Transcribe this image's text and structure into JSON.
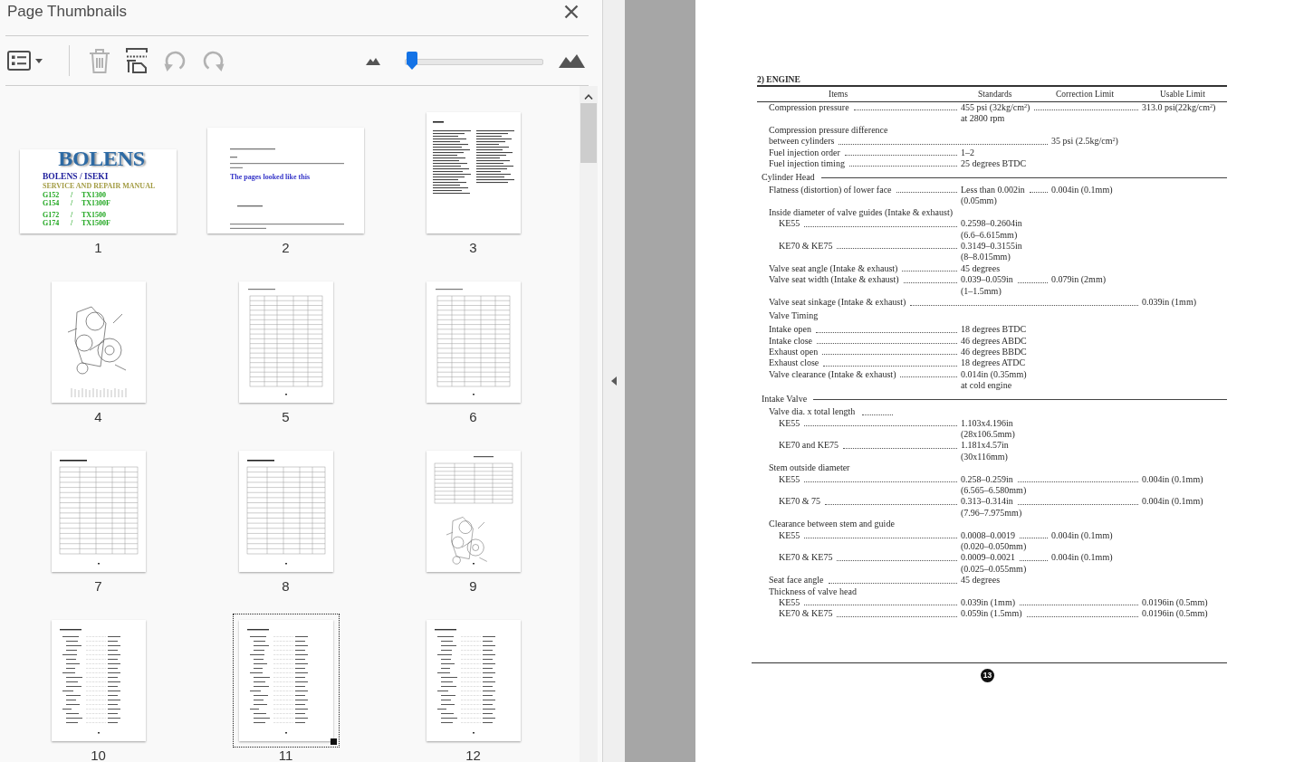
{
  "panel": {
    "title": "Page Thumbnails"
  },
  "toolbar": {
    "buttons": [
      {
        "kind": "options",
        "disabled": false
      },
      {
        "kind": "delete",
        "disabled": true
      },
      {
        "kind": "insert",
        "disabled": false
      },
      {
        "kind": "ccw",
        "disabled": true
      },
      {
        "kind": "cw",
        "disabled": true
      }
    ],
    "slider": {
      "level": 0.05
    }
  },
  "thumbnails": [
    {
      "label": "1",
      "kind": "cover",
      "selected": false,
      "title": "BOLENS",
      "subtitle": "BOLENS / ISEKI",
      "caption": "SERVICE AND REPAIR MANUAL",
      "model_groups": [
        [
          [
            "G152",
            "/",
            "TX1300"
          ],
          [
            "G154",
            "/",
            "TX1300F"
          ]
        ],
        [
          [
            "G172",
            "/",
            "TX1500"
          ],
          [
            "G174",
            "/",
            "TX1500F"
          ]
        ]
      ]
    },
    {
      "label": "2",
      "kind": "note",
      "selected": false,
      "notice": "The pages looked like this"
    },
    {
      "label": "3",
      "kind": "toc",
      "selected": false
    },
    {
      "label": "4",
      "kind": "figure",
      "selected": false
    },
    {
      "label": "5",
      "kind": "grid",
      "selected": false
    },
    {
      "label": "6",
      "kind": "grid",
      "selected": false
    },
    {
      "label": "7",
      "kind": "table",
      "selected": false
    },
    {
      "label": "8",
      "kind": "table",
      "selected": false
    },
    {
      "label": "9",
      "kind": "diagram",
      "selected": false
    },
    {
      "label": "10",
      "kind": "list",
      "selected": false
    },
    {
      "label": "11",
      "kind": "list",
      "selected": true
    },
    {
      "label": "12",
      "kind": "list",
      "selected": false
    }
  ],
  "document": {
    "title": "2) ENGINE",
    "columns": [
      "Items",
      "Standards",
      "Correction Limit",
      "Usable Limit"
    ],
    "sections": [
      {
        "entries": [
          {
            "kind": "spec",
            "label": "Compression pressure",
            "standard": [
              "455 psi (32kg/cm$^{2}$)",
              "at 2800 rpm"
            ],
            "usable": [
              "313.0 psi(22kg/cm$^{2}$)"
            ]
          },
          {
            "kind": "spec",
            "label_lead": "Compression pressure difference",
            "label": "between cylinders",
            "correction": [
              "35 psi (2.5kg/cm$^{2}$)"
            ]
          },
          {
            "kind": "spec",
            "label": "Fuel injection order",
            "standard": [
              "1–2"
            ]
          },
          {
            "kind": "spec",
            "label": "Fuel injection timing",
            "standard": [
              "25 degrees BTDC"
            ]
          }
        ]
      },
      {
        "heading": "Cylinder Head",
        "entries": [
          {
            "kind": "spec",
            "label": "Flatness (distortion) of lower face",
            "standard": [
              "Less than 0.002in",
              "(0.05mm)"
            ],
            "correction": [
              "0.004in (0.1mm)"
            ]
          },
          {
            "kind": "group",
            "label": "Inside diameter of valve guides (Intake & exhaust)",
            "leader": false,
            "children": [
              {
                "label": "KE55",
                "standard": [
                  "0.2598–0.2604in",
                  "(6.6–6.615mm)"
                ]
              },
              {
                "label": "KE70 & KE75",
                "standard": [
                  "0.3149–0.3155in",
                  "(8–8.015mm)"
                ]
              }
            ]
          },
          {
            "kind": "spec",
            "label": "Valve seat angle (Intake & exhaust)",
            "standard": [
              "45 degrees"
            ]
          },
          {
            "kind": "spec",
            "label": "Valve seat width (Intake & exhaust)",
            "standard": [
              "0.039–0.059in",
              "(1–1.5mm)"
            ],
            "correction": [
              "0.079in (2mm)"
            ]
          },
          {
            "kind": "spec",
            "label": "Valve seat sinkage (Intake & exhaust)",
            "usable": [
              "0.039in (1mm)"
            ]
          },
          {
            "kind": "subheading",
            "label": "Valve Timing"
          },
          {
            "kind": "spec",
            "label": "Intake open",
            "standard": [
              "18 degrees BTDC"
            ]
          },
          {
            "kind": "spec",
            "label": "Intake close",
            "standard": [
              "46 degrees ABDC"
            ]
          },
          {
            "kind": "spec",
            "label": "Exhaust open",
            "standard": [
              "46 degrees BBDC"
            ]
          },
          {
            "kind": "spec",
            "label": "Exhaust close",
            "standard": [
              "18 degrees ATDC"
            ]
          },
          {
            "kind": "spec",
            "label": "Valve clearance (Intake & exhaust)",
            "standard": [
              "0.014in (0.35mm)",
              "at cold engine"
            ]
          }
        ]
      },
      {
        "heading": "Intake Valve",
        "entries": [
          {
            "kind": "group",
            "label": "Valve dia. x total length",
            "leader": true,
            "children": [
              {
                "label": "KE55",
                "standard": [
                  "1.103x4.196in",
                  "(28x106.5mm)"
                ]
              },
              {
                "label": "KE70 and KE75",
                "standard": [
                  "1.181x4.57in",
                  "(30x116mm)"
                ]
              }
            ]
          },
          {
            "kind": "group",
            "label": "Stem outside diameter",
            "leader": false,
            "children": [
              {
                "label": "KE55",
                "standard": [
                  "0.258–0.259in",
                  "(6.565–6.580mm)"
                ],
                "usable": [
                  "0.004in (0.1mm)"
                ]
              },
              {
                "label": "KE70 & 75",
                "standard": [
                  "0.313–0.314in",
                  "(7.96–7.975mm)"
                ],
                "usable": [
                  "0.004in (0.1mm)"
                ]
              }
            ]
          },
          {
            "kind": "group",
            "label": "Clearance between stem and guide",
            "leader": false,
            "children": [
              {
                "label": "KE55",
                "standard": [
                  "0.0008–0.0019",
                  "(0.020–0.050mm)"
                ],
                "correction": [
                  "0.004in (0.1mm)"
                ]
              },
              {
                "label": "KE70 & KE75",
                "standard": [
                  "0.0009–0.0021",
                  "(0.025–0.055mm)"
                ],
                "correction": [
                  "0.004in (0.1mm)"
                ]
              }
            ]
          },
          {
            "kind": "spec",
            "label": "Seat face angle",
            "standard": [
              "45 degrees"
            ]
          },
          {
            "kind": "group",
            "label": "Thickness of valve head",
            "leader": false,
            "children": [
              {
                "label": "KE55",
                "standard": [
                  "0.039in (1mm)"
                ],
                "usable": [
                  "0.0196in (0.5mm)"
                ]
              },
              {
                "label": "KE70 & KE75",
                "standard": [
                  "0.059in (1.5mm)"
                ],
                "usable": [
                  "0.0196in (0.5mm)"
                ]
              }
            ]
          }
        ]
      }
    ],
    "page_number": "13"
  }
}
